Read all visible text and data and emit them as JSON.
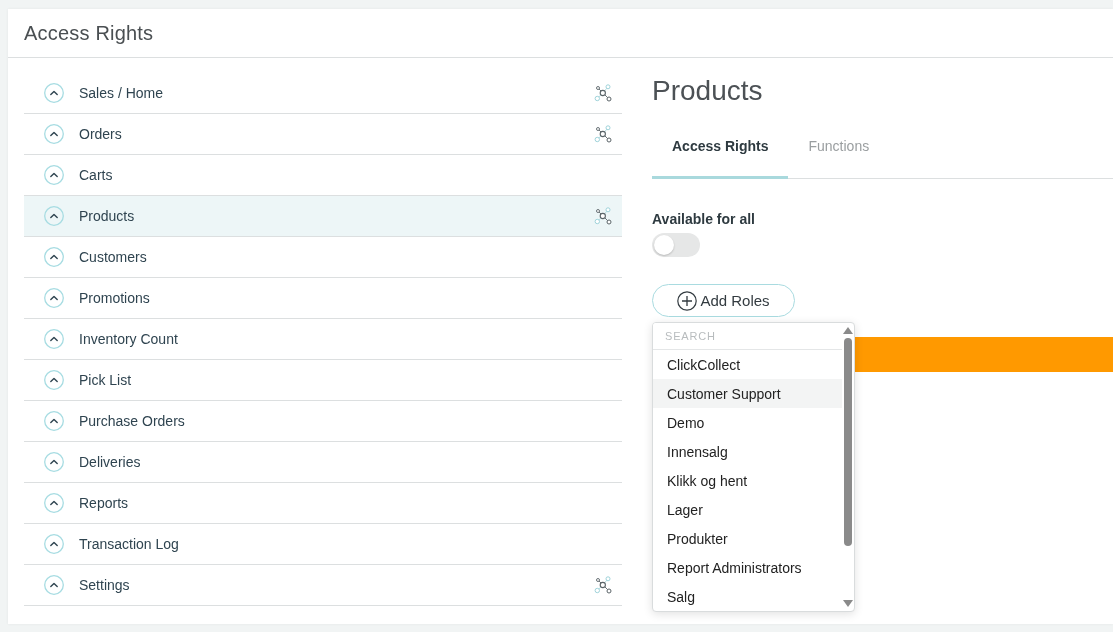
{
  "page": {
    "title": "Access Rights"
  },
  "sidebar": {
    "items": [
      {
        "label": "Sales / Home",
        "selected": false,
        "connected": true
      },
      {
        "label": "Orders",
        "selected": false,
        "connected": true
      },
      {
        "label": "Carts",
        "selected": false,
        "connected": false
      },
      {
        "label": "Products",
        "selected": true,
        "connected": true
      },
      {
        "label": "Customers",
        "selected": false,
        "connected": false
      },
      {
        "label": "Promotions",
        "selected": false,
        "connected": false
      },
      {
        "label": "Inventory Count",
        "selected": false,
        "connected": false
      },
      {
        "label": "Pick List",
        "selected": false,
        "connected": false
      },
      {
        "label": "Purchase Orders",
        "selected": false,
        "connected": false
      },
      {
        "label": "Deliveries",
        "selected": false,
        "connected": false
      },
      {
        "label": "Reports",
        "selected": false,
        "connected": false
      },
      {
        "label": "Transaction Log",
        "selected": false,
        "connected": false
      },
      {
        "label": "Settings",
        "selected": false,
        "connected": true
      }
    ]
  },
  "detail": {
    "title": "Products",
    "tabs": [
      {
        "label": "Access Rights",
        "selected": true
      },
      {
        "label": "Functions",
        "selected": false
      }
    ],
    "available_for_all": {
      "label": "Available for all",
      "on": false
    },
    "add_roles_button": {
      "label": "Add Roles"
    },
    "roles_dropdown": {
      "search": {
        "placeholder": "SEARCH"
      },
      "options": [
        {
          "label": "ClickCollect",
          "highlighted": false
        },
        {
          "label": "Customer Support",
          "highlighted": true
        },
        {
          "label": "Demo",
          "highlighted": false
        },
        {
          "label": "Innensalg",
          "highlighted": false
        },
        {
          "label": "Klikk og hent",
          "highlighted": false
        },
        {
          "label": "Lager",
          "highlighted": false
        },
        {
          "label": "Produkter",
          "highlighted": false
        },
        {
          "label": "Report Administrators",
          "highlighted": false
        },
        {
          "label": "Salg",
          "highlighted": false
        }
      ]
    }
  }
}
